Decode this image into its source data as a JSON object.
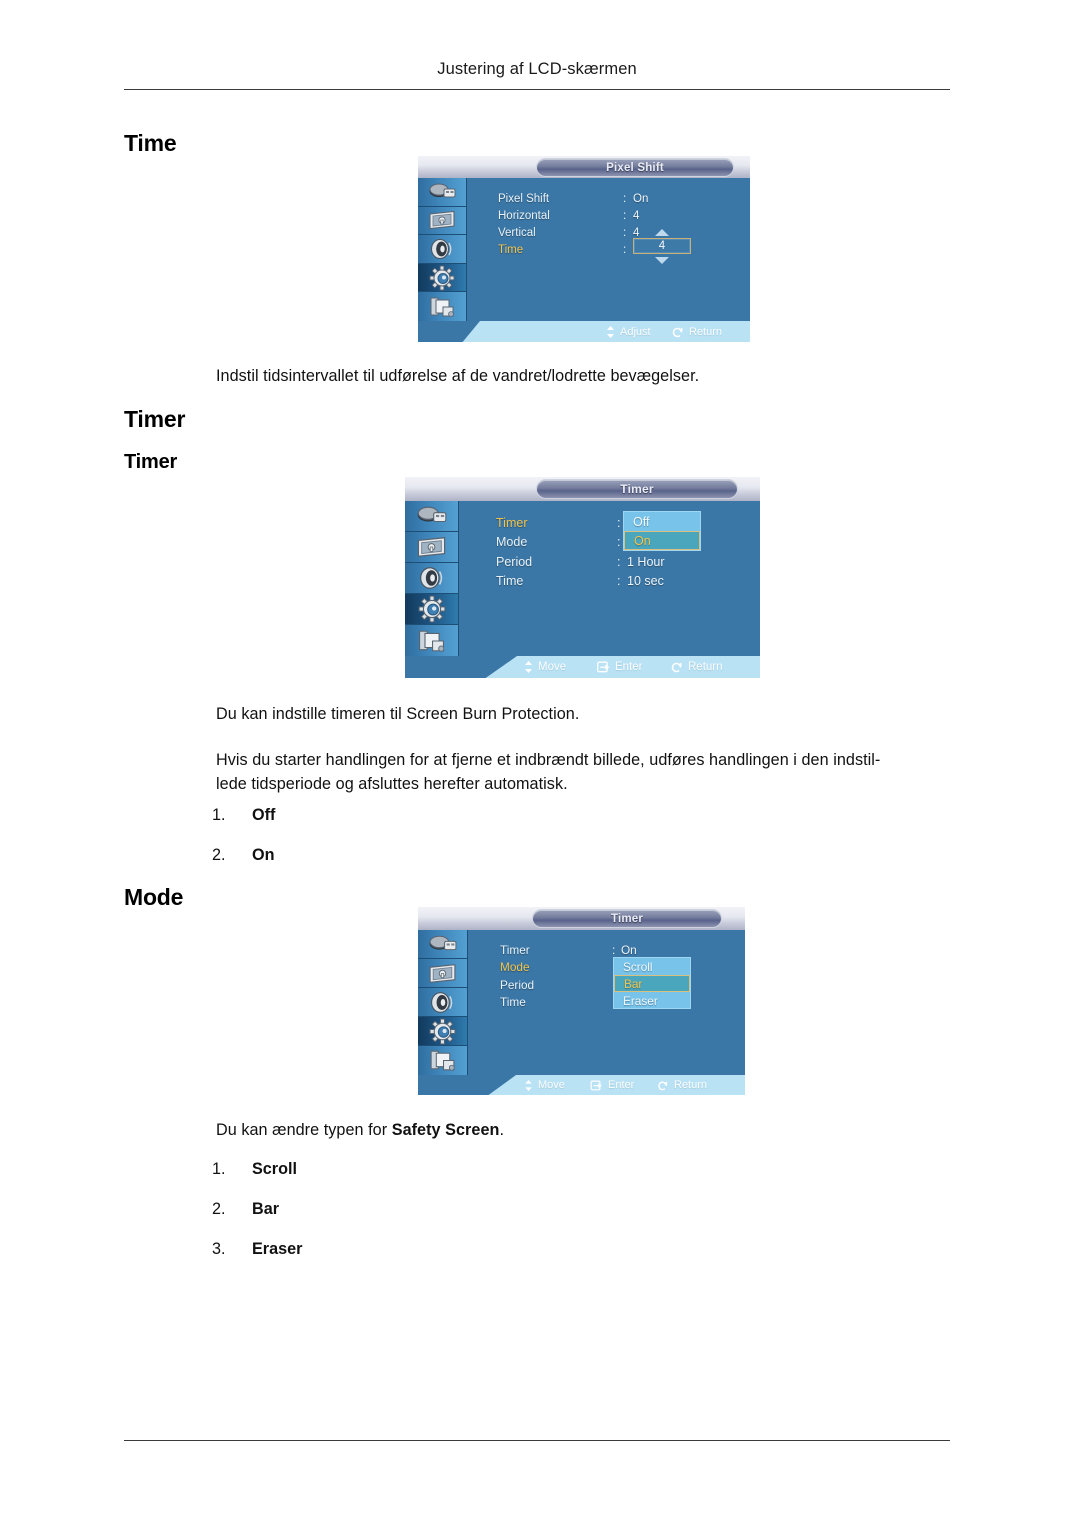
{
  "page": {
    "running_head": "Justering af LCD-skærmen"
  },
  "sections": [
    {
      "heading": "Time",
      "caption": "Indstil tidsintervallet til udførelse af de vandret/lodrette bevægelser."
    },
    {
      "heading": "Timer",
      "subheading": "Timer",
      "paragraph1": "Du kan indstille timeren til Screen Burn Protection.",
      "paragraph2_line1": "Hvis du starter handlingen for at fjerne et indbrændt billede, udføres handlingen i den indstil-",
      "paragraph2_line2": "lede tidsperiode og afsluttes herefter automatisk.",
      "list": [
        {
          "num": "1.",
          "text": "Off"
        },
        {
          "num": "2.",
          "text": "On"
        }
      ]
    },
    {
      "heading": "Mode",
      "caption_pre": "Du kan ændre typen for ",
      "caption_bold": "Safety Screen",
      "caption_post": ".",
      "list": [
        {
          "num": "1.",
          "text": "Scroll"
        },
        {
          "num": "2.",
          "text": "Bar"
        },
        {
          "num": "3.",
          "text": "Eraser"
        }
      ]
    }
  ],
  "osd1": {
    "title": "Pixel Shift",
    "icons": [
      "input-source-icon",
      "picture-icon",
      "sound-speaker-icon",
      "setup-gear-icon",
      "multi-control-icon"
    ],
    "active_icon_index": 3,
    "rows": [
      {
        "label": "Pixel Shift",
        "value": "On",
        "selected": false
      },
      {
        "label": "Horizontal",
        "value": "4",
        "selected": false
      },
      {
        "label": "Vertical",
        "value": "4",
        "selected": false
      },
      {
        "label": "Time",
        "value": "4",
        "selected": true,
        "control": "spinner"
      }
    ],
    "footer": [
      {
        "icon": "updown-arrow-icon",
        "label": "Adjust"
      },
      {
        "icon": "return-arrow-icon",
        "label": "Return"
      }
    ]
  },
  "osd2": {
    "title": "Timer",
    "icons": [
      "input-source-icon",
      "picture-icon",
      "sound-speaker-icon",
      "setup-gear-icon",
      "multi-control-icon"
    ],
    "active_icon_index": 3,
    "rows": [
      {
        "label": "Timer",
        "value": "",
        "selected": true
      },
      {
        "label": "Mode",
        "value": "",
        "selected": false
      },
      {
        "label": "Period",
        "value": "1 Hour",
        "selected": false
      },
      {
        "label": "Time",
        "value": "10 sec",
        "selected": false
      }
    ],
    "dropdown": {
      "options": [
        "Off",
        "On"
      ],
      "selected_index": 1
    },
    "footer": [
      {
        "icon": "updown-arrow-icon",
        "label": "Move"
      },
      {
        "icon": "enter-key-icon",
        "label": "Enter"
      },
      {
        "icon": "return-arrow-icon",
        "label": "Return"
      }
    ]
  },
  "osd3": {
    "title": "Timer",
    "icons": [
      "input-source-icon",
      "picture-icon",
      "sound-speaker-icon",
      "setup-gear-icon",
      "multi-control-icon"
    ],
    "active_icon_index": 3,
    "rows": [
      {
        "label": "Timer",
        "value": "On",
        "selected": false
      },
      {
        "label": "Mode",
        "value": "",
        "selected": true
      },
      {
        "label": "Period",
        "value": "",
        "selected": false
      },
      {
        "label": "Time",
        "value": "",
        "selected": false
      }
    ],
    "dropdown": {
      "options": [
        "Scroll",
        "Bar",
        "Eraser"
      ],
      "selected_index": 1
    },
    "footer": [
      {
        "icon": "updown-arrow-icon",
        "label": "Move"
      },
      {
        "icon": "enter-key-icon",
        "label": "Enter"
      },
      {
        "icon": "return-arrow-icon",
        "label": "Return"
      }
    ]
  },
  "colors": {
    "osd_body": "#3b77a6",
    "osd_sidebar": "#3f86bb",
    "osd_footer": "#b9e2f5",
    "selected_label": "#f2c44a",
    "dropdown_bg": "#77c3ea",
    "dropdown_selected_bg": "#4aa6bd"
  }
}
